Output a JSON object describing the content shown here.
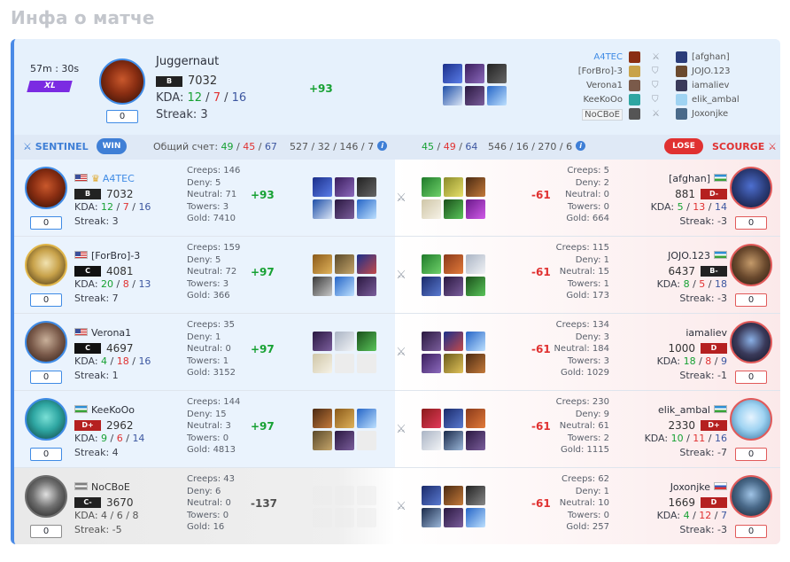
{
  "page_title": "Инфа о матче",
  "summary": {
    "duration": "57m : 30s",
    "mode": "XL",
    "hero": "Juggernaut",
    "rank": "B",
    "rating": "7032",
    "kda_label": "KDA:",
    "kills": "12",
    "deaths": "7",
    "assists": "16",
    "streak_label": "Streak: 3",
    "streak_box": "0",
    "delta": "+93",
    "roster": [
      {
        "left": "A4TEC",
        "right": "[afghan]",
        "left_hl": true
      },
      {
        "left": "[ForBro]-3",
        "right": "JOJO.123"
      },
      {
        "left": "Verona1",
        "right": "iamaliev"
      },
      {
        "left": "KeeKoOo",
        "right": "elik_ambal"
      },
      {
        "left": "NoCBoE",
        "right": "Joxonjke",
        "boxed": true
      }
    ]
  },
  "teambar": {
    "sentinel": "SENTINEL",
    "win": "WIN",
    "score_label": "Общий счет:",
    "left_kills": "49",
    "left_deaths": "45",
    "left_assists": "67",
    "left_stats": "527 / 32 / 146 / 7",
    "right_kills": "45",
    "right_deaths": "49",
    "right_assists": "64",
    "right_stats": "546 / 16 / 270 / 6",
    "lose": "LOSE",
    "scourge": "SCOURGE"
  },
  "labels": {
    "creeps": "Creeps:",
    "deny": "Deny:",
    "neutral": "Neutral:",
    "towers": "Towers:",
    "gold": "Gold:",
    "kda": "KDA:",
    "streak": "Streak:"
  },
  "rows": [
    {
      "left": {
        "name": "A4TEC",
        "rank": "B",
        "rating": "7032",
        "k": "12",
        "d": "7",
        "a": "16",
        "streak": "3",
        "box": "0",
        "creeps": "146",
        "deny": "5",
        "neutral": "71",
        "towers": "3",
        "gold": "7410",
        "delta": "+93"
      },
      "right": {
        "name": "[afghan]",
        "rank": "D-",
        "rating": "881",
        "k": "5",
        "d": "13",
        "a": "14",
        "streak": "-3",
        "box": "0",
        "creeps": "5",
        "deny": "2",
        "neutral": "0",
        "towers": "0",
        "gold": "664",
        "delta": "-61"
      }
    },
    {
      "left": {
        "name": "[ForBro]-3",
        "rank": "C",
        "rating": "4081",
        "k": "20",
        "d": "8",
        "a": "13",
        "streak": "7",
        "box": "0",
        "creeps": "159",
        "deny": "5",
        "neutral": "72",
        "towers": "3",
        "gold": "366",
        "delta": "+97"
      },
      "right": {
        "name": "JOJO.123",
        "rank": "B-",
        "rating": "6437",
        "k": "8",
        "d": "5",
        "a": "18",
        "streak": "-3",
        "box": "0",
        "creeps": "115",
        "deny": "1",
        "neutral": "15",
        "towers": "1",
        "gold": "173",
        "delta": "-61"
      }
    },
    {
      "left": {
        "name": "Verona1",
        "rank": "C",
        "rating": "4697",
        "k": "4",
        "d": "18",
        "a": "16",
        "streak": "1",
        "box": "0",
        "creeps": "35",
        "deny": "1",
        "neutral": "0",
        "towers": "1",
        "gold": "3152",
        "delta": "+97"
      },
      "right": {
        "name": "iamaliev",
        "rank": "D",
        "rating": "1000",
        "k": "18",
        "d": "8",
        "a": "9",
        "streak": "-1",
        "box": "0",
        "creeps": "134",
        "deny": "3",
        "neutral": "184",
        "towers": "3",
        "gold": "1029",
        "delta": "-61"
      }
    },
    {
      "left": {
        "name": "KeeKoOo",
        "rank": "D+",
        "rating": "2962",
        "k": "9",
        "d": "6",
        "a": "14",
        "streak": "4",
        "box": "0",
        "creeps": "144",
        "deny": "15",
        "neutral": "3",
        "towers": "0",
        "gold": "4813",
        "delta": "+97"
      },
      "right": {
        "name": "elik_ambal",
        "rank": "D+",
        "rating": "2330",
        "k": "10",
        "d": "11",
        "a": "16",
        "streak": "-7",
        "box": "0",
        "creeps": "230",
        "deny": "9",
        "neutral": "61",
        "towers": "2",
        "gold": "1115",
        "delta": "-61"
      }
    },
    {
      "left": {
        "name": "NoCBoE",
        "rank": "C-",
        "rating": "3670",
        "k": "4",
        "d": "6",
        "a": "8",
        "streak": "-5",
        "box": "0",
        "creeps": "43",
        "deny": "6",
        "neutral": "0",
        "towers": "0",
        "gold": "16",
        "delta": "-137"
      },
      "right": {
        "name": "Joxonjke",
        "rank": "D",
        "rating": "1669",
        "k": "4",
        "d": "12",
        "a": "7",
        "streak": "-3",
        "box": "0",
        "creeps": "62",
        "deny": "1",
        "neutral": "10",
        "towers": "0",
        "gold": "257",
        "delta": "-61"
      }
    }
  ]
}
